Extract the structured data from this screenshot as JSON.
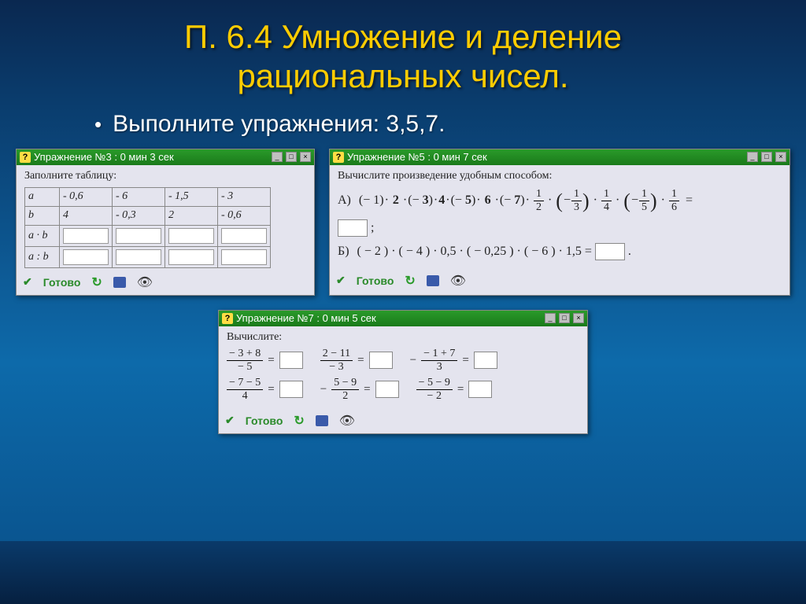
{
  "title_line1": "П. 6.4 Умножение и деление",
  "title_line2": "рациональных чисел.",
  "subtitle": "Выполните упражнения: 3,5,7.",
  "panel3": {
    "titlebar": "Упражнение №3 : 0 мин  3 сек",
    "prompt": "Заполните таблицу:",
    "rows": {
      "hdr_a": "a",
      "hdr_b": "b",
      "hdr_ab": "a · b",
      "hdr_adivb": "a : b",
      "a": [
        "- 0,6",
        "- 6",
        "- 1,5",
        "- 3"
      ],
      "b": [
        "4",
        "- 0,3",
        "2",
        "- 0,6"
      ]
    }
  },
  "panel5": {
    "titlebar": "Упражнение №5 : 0 мин  7 сек",
    "prompt": "Вычислите произведение удобным способом:",
    "lineA_label": "A)",
    "lineB_label": "Б)",
    "lineB_expr": "( − 2 ) · ( − 4 ) · 0,5 · ( − 0,25 ) · ( − 6 ) · 1,5  ="
  },
  "panel7": {
    "titlebar": "Упражнение №7 : 0 мин  5 сек",
    "prompt": "Вычислите:",
    "eqns_r1": [
      {
        "num": "− 3 + 8",
        "den": "− 5"
      },
      {
        "num": "2 − 11",
        "den": "− 3"
      },
      {
        "num": "− 1 + 7",
        "den": "3",
        "neg": true
      }
    ],
    "eqns_r2": [
      {
        "num": "− 7 − 5",
        "den": "4"
      },
      {
        "num": "5 − 9",
        "den": "2",
        "neg": true
      },
      {
        "num": "− 5 − 9",
        "den": "− 2"
      }
    ]
  },
  "status": {
    "ready": "Готово"
  }
}
